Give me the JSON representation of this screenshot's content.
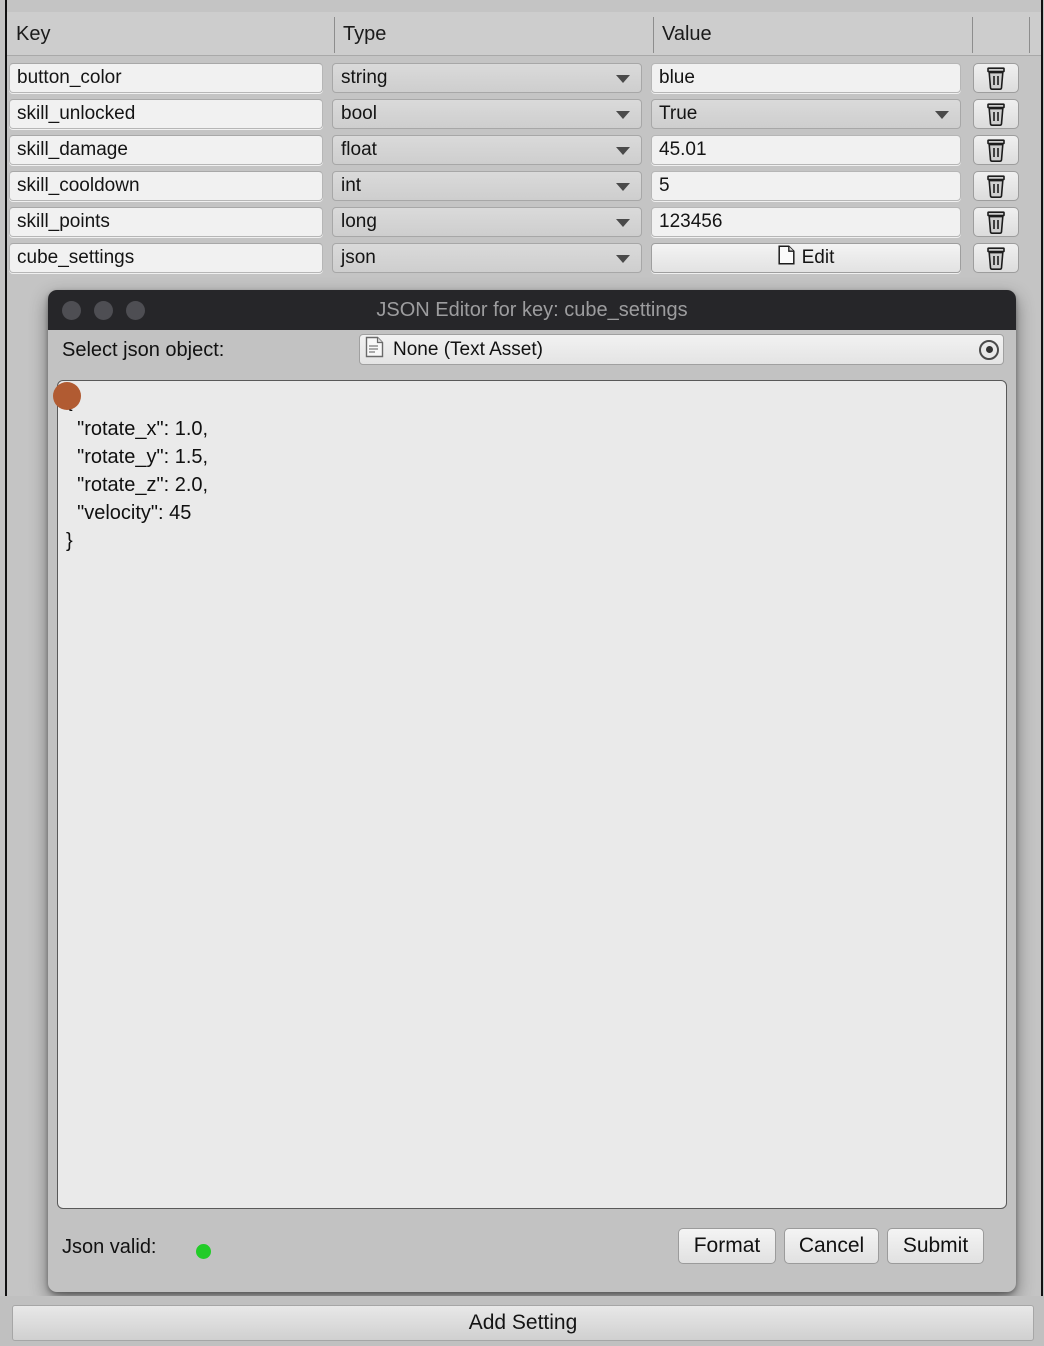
{
  "table": {
    "headers": {
      "key": "Key",
      "type": "Type",
      "value": "Value"
    },
    "rows": [
      {
        "key": "button_color",
        "type": "string",
        "value": "blue",
        "value_kind": "text",
        "delete_icon": "trash-icon"
      },
      {
        "key": "skill_unlocked",
        "type": "bool",
        "value": "True",
        "value_kind": "dropdown",
        "delete_icon": "trash-icon"
      },
      {
        "key": "skill_damage",
        "type": "float",
        "value": "45.01",
        "value_kind": "text",
        "delete_icon": "trash-icon"
      },
      {
        "key": "skill_cooldown",
        "type": "int",
        "value": "5",
        "value_kind": "text",
        "delete_icon": "trash-icon"
      },
      {
        "key": "skill_points",
        "type": "long",
        "value": "123456",
        "value_kind": "text",
        "delete_icon": "trash-icon"
      },
      {
        "key": "cube_settings",
        "type": "json",
        "value": "Edit",
        "value_kind": "button",
        "delete_icon": "trash-icon"
      }
    ]
  },
  "dialog": {
    "title": "JSON Editor for key: cube_settings",
    "window_buttons": [
      "close-dot",
      "minimize-dot",
      "zoom-dot"
    ],
    "object_label": "Select json object:",
    "object_value": "None (Text Asset)",
    "object_icon": "text-asset-icon",
    "picker_icon": "object-picker-icon",
    "json_text": "{\n  \"rotate_x\": 1.0,\n  \"rotate_y\": 1.5,\n  \"rotate_z\": 2.0,\n  \"velocity\": 45\n}",
    "json_values": {
      "rotate_x": 1.0,
      "rotate_y": 1.5,
      "rotate_z": 2.0,
      "velocity": 45
    },
    "valid_label": "Json valid:",
    "valid_state_color": "#22cc28",
    "buttons": {
      "format": "Format",
      "cancel": "Cancel",
      "submit": "Submit"
    }
  },
  "footer": {
    "add_setting": "Add Setting"
  },
  "cursor": {
    "color": "#b15b32"
  }
}
